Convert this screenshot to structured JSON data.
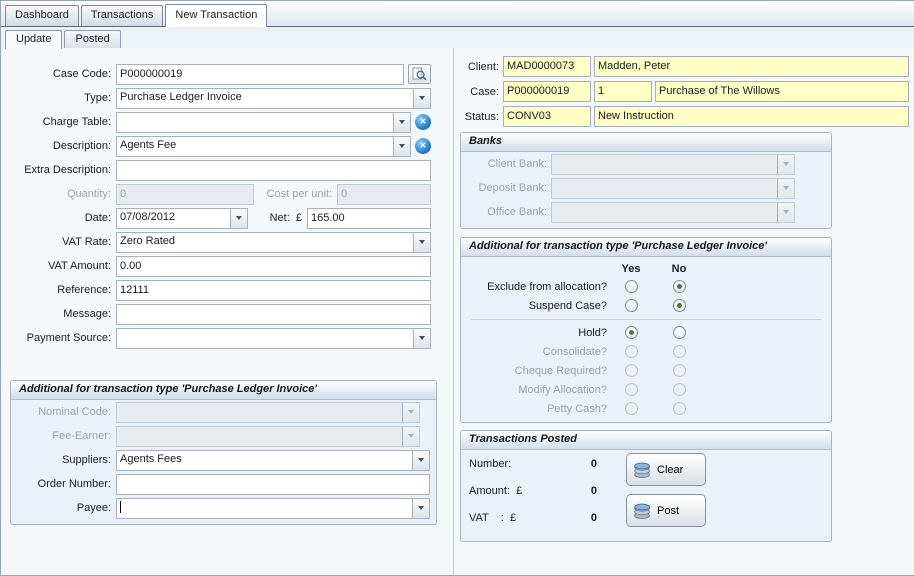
{
  "top_tabs": [
    {
      "label": "Dashboard"
    },
    {
      "label": "Transactions"
    },
    {
      "label": "New Transaction"
    }
  ],
  "sub_tabs": [
    {
      "label": "Update"
    },
    {
      "label": "Posted"
    }
  ],
  "icons": {
    "clear_glyph": "✕"
  },
  "form": {
    "case_code": {
      "label": "Case Code:",
      "value": "P000000019"
    },
    "type": {
      "label": "Type:",
      "value": "Purchase Ledger Invoice"
    },
    "charge_table": {
      "label": "Charge Table:",
      "value": ""
    },
    "description": {
      "label": "Description:",
      "value": "Agents Fee"
    },
    "extra_description": {
      "label": "Extra Description:",
      "value": ""
    },
    "quantity": {
      "label": "Quantity:",
      "value": "0"
    },
    "cost_per_unit": {
      "label": "Cost per unit:",
      "value": "0"
    },
    "date": {
      "label": "Date:",
      "value": "07/08/2012"
    },
    "net": {
      "label": "Net:  £",
      "value": "165.00"
    },
    "vat_rate": {
      "label": "VAT Rate:",
      "value": "Zero Rated"
    },
    "vat_amount": {
      "label": "VAT Amount:",
      "value": "0.00"
    },
    "reference": {
      "label": "Reference:",
      "value": "12111"
    },
    "message": {
      "label": "Message:",
      "value": ""
    },
    "payment_source": {
      "label": "Payment Source:",
      "value": ""
    }
  },
  "additional_left": {
    "title": "Additional for transaction type 'Purchase Ledger Invoice'",
    "nominal_code": {
      "label": "Nominal Code:",
      "value": ""
    },
    "fee_earner": {
      "label": "Fee-Earner:",
      "value": ""
    },
    "suppliers": {
      "label": "Suppliers:",
      "value": "Agents Fees"
    },
    "order_number": {
      "label": "Order Number:",
      "value": ""
    },
    "payee": {
      "label": "Payee:",
      "value": ""
    }
  },
  "client_info": {
    "client": {
      "label": "Client:",
      "code": "MAD0000073",
      "name": "Madden, Peter"
    },
    "case": {
      "label": "Case:",
      "code": "P000000019",
      "number": "1",
      "description": "Purchase of The Willows"
    },
    "status": {
      "label": "Status:",
      "code": "CONV03",
      "description": "New Instruction"
    }
  },
  "banks": {
    "title": "Banks",
    "client_bank": {
      "label": "Client Bank:",
      "value": ""
    },
    "deposit_bank": {
      "label": "Deposit Bank:",
      "value": ""
    },
    "office_bank": {
      "label": "Office Bank:",
      "value": ""
    }
  },
  "additional_right": {
    "title": "Additional for transaction type 'Purchase Ledger Invoice'",
    "yes_header": "Yes",
    "no_header": "No",
    "rows": [
      {
        "label": "Exclude from allocation?",
        "selected": "no",
        "enabled": true
      },
      {
        "label": "Suspend Case?",
        "selected": "no",
        "enabled": true
      },
      {
        "label": "Hold?",
        "selected": "yes",
        "enabled": true
      },
      {
        "label": "Consolidate?",
        "selected": null,
        "enabled": false
      },
      {
        "label": "Cheque Required?",
        "selected": null,
        "enabled": false
      },
      {
        "label": "Modify Allocation?",
        "selected": null,
        "enabled": false
      },
      {
        "label": "Petty Cash?",
        "selected": null,
        "enabled": false
      }
    ]
  },
  "transactions_posted": {
    "title": "Transactions Posted",
    "number": {
      "label": "Number:",
      "value": "0"
    },
    "amount": {
      "label": "Amount:  £",
      "value": "0"
    },
    "vat": {
      "label": "VAT    :  £",
      "value": "0"
    },
    "clear_label": "Clear",
    "post_label": "Post"
  }
}
